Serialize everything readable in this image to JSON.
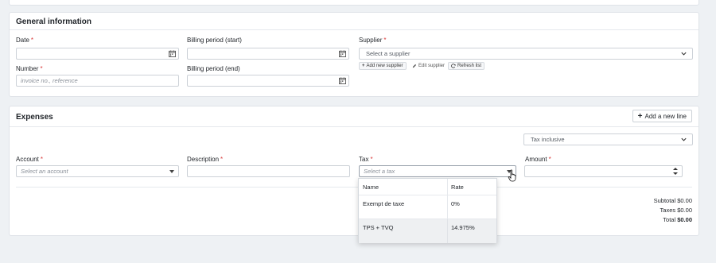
{
  "general": {
    "title": "General information",
    "date_label": "Date",
    "billing_start_label": "Billing period (start)",
    "supplier_label": "Supplier",
    "supplier_placeholder": "Select a supplier",
    "number_label": "Number",
    "number_placeholder": "invoice no., reference",
    "billing_end_label": "Billing period (end)",
    "add_supplier": "Add new supplier",
    "edit_supplier": "Edit supplier",
    "refresh_list": "Refresh list",
    "required_mark": "*"
  },
  "expenses": {
    "title": "Expenses",
    "add_line": "Add a new line",
    "tax_mode": "Tax inclusive",
    "account_label": "Account",
    "account_placeholder": "Select an account",
    "description_label": "Description",
    "tax_label": "Tax",
    "tax_placeholder": "Select a tax",
    "amount_label": "Amount"
  },
  "totals": {
    "subtotal_label": "Subtotal",
    "subtotal_value": "$0.00",
    "taxes_label": "Taxes",
    "taxes_value": "$0.00",
    "total_label": "Total",
    "total_value": "$0.00"
  },
  "tax_dropdown": {
    "col_name": "Name",
    "col_rate": "Rate",
    "rows": [
      {
        "name": "Exempt de taxe",
        "rate": "0%"
      },
      {
        "name": "TPS + TVQ",
        "rate": "14.975%"
      }
    ]
  }
}
